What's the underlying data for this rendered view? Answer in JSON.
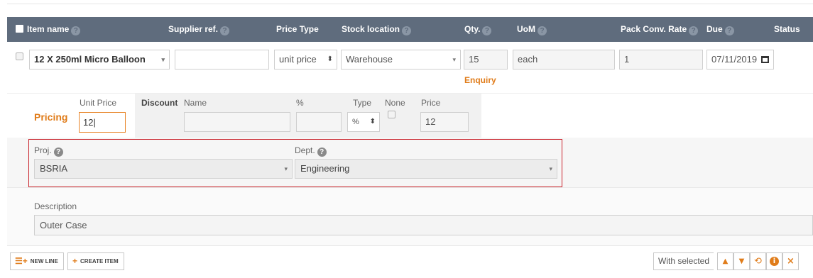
{
  "header": {
    "item_name": "Item name",
    "supplier_ref": "Supplier ref.",
    "price_type": "Price Type",
    "stock_location": "Stock location",
    "qty": "Qty.",
    "uom": "UoM",
    "pack_conv_rate": "Pack Conv. Rate",
    "due": "Due",
    "status": "Status"
  },
  "line": {
    "item_name": "12 X 250ml Micro Balloon",
    "supplier_ref": "",
    "price_type": "unit price",
    "stock_location": "Warehouse",
    "qty": "15",
    "status_label": "Enquiry",
    "uom": "each",
    "pack_conv_rate": "1",
    "due": "07/11/2019"
  },
  "pricing": {
    "title": "Pricing",
    "unit_price_label": "Unit Price",
    "unit_price_value": "12",
    "discount_label": "Discount",
    "name_label": "Name",
    "name_value": "",
    "percent_label": "%",
    "percent_value": "",
    "type_label": "Type",
    "type_value": "%",
    "none_label": "None",
    "price_label": "Price",
    "price_value": "12"
  },
  "project": {
    "proj_label": "Proj.",
    "proj_value": "BSRIA",
    "dept_label": "Dept.",
    "dept_value": "Engineering"
  },
  "description": {
    "label": "Description",
    "value": "Outer Case"
  },
  "footer": {
    "new_line": "NEW LINE",
    "create_item": "CREATE ITEM",
    "with_selected": "With selected"
  },
  "colors": {
    "header_bg": "#5f6c7d",
    "accent": "#e07c1a",
    "highlight_border": "#c9222a"
  }
}
